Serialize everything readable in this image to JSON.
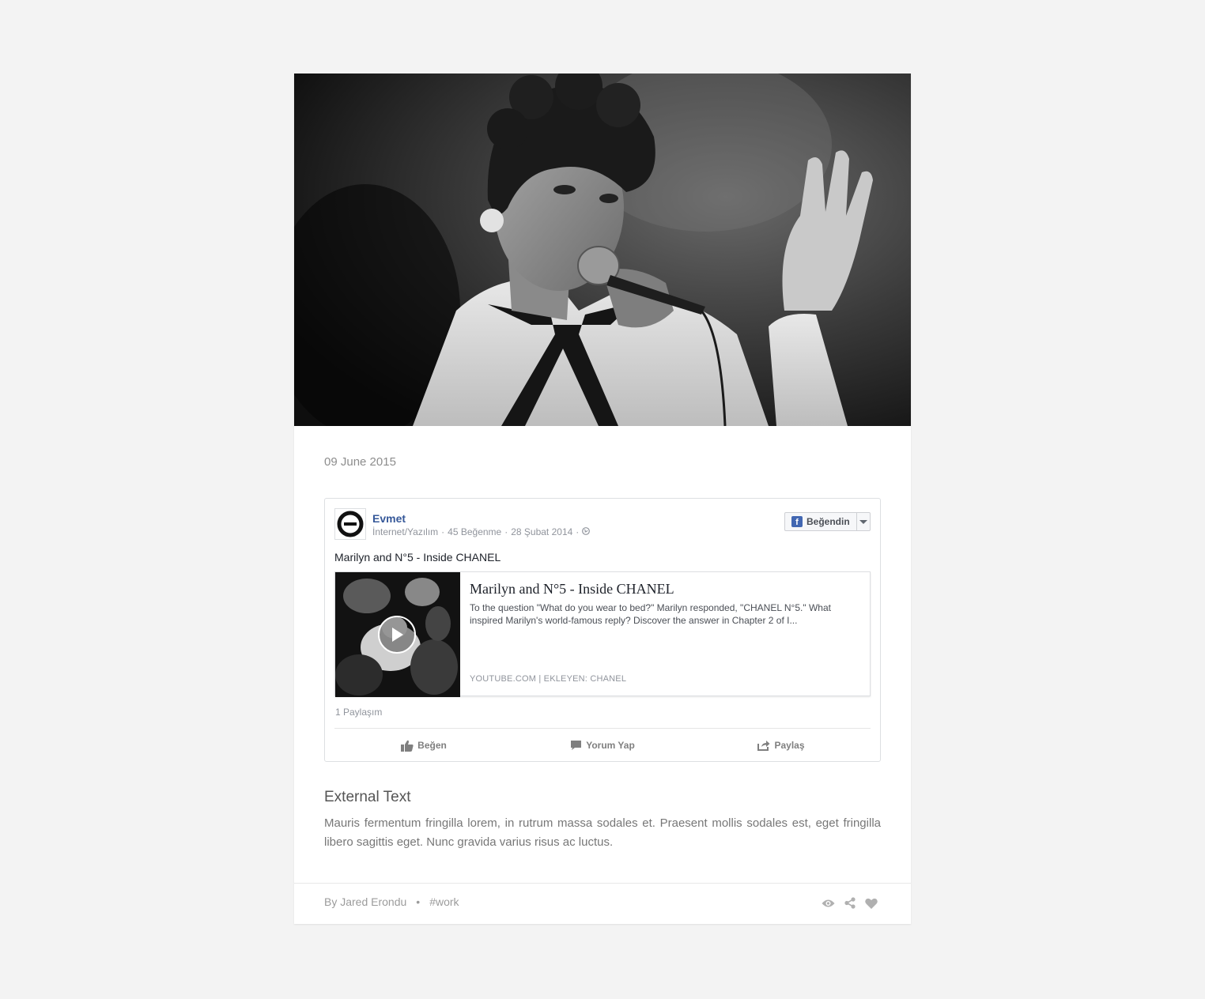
{
  "post": {
    "date": "09 June 2015",
    "external_title": "External Text",
    "external_body": "Mauris fermentum fringilla lorem, in rutrum massa sodales et. Praesent mollis sodales est, eget fringilla libero sagittis eget. Nunc gravida varius risus ac luctus.",
    "author": "By Jared Erondu",
    "separator": "•",
    "tag": "#work"
  },
  "fb_embed": {
    "page_name": "Evmet",
    "category": "İnternet/Yazılım",
    "likes": "45 Beğenme",
    "post_date": "28 Şubat 2014",
    "meta_sep": "·",
    "like_button": "Beğendin",
    "post_text": "Marilyn and N°5 - Inside CHANEL",
    "link_title": "Marilyn and N°5 - Inside CHANEL",
    "link_desc": "To the question \"What do you wear to bed?\" Marilyn responded, \"CHANEL N°5.\" What inspired Marilyn's world-famous reply? Discover the answer in Chapter 2 of I...",
    "link_source": "YOUTUBE.COM | EKLEYEN: CHANEL",
    "shares": "1 Paylaşım",
    "actions": {
      "like": "Beğen",
      "comment": "Yorum Yap",
      "share": "Paylaş"
    }
  },
  "icons": {
    "globe": "globe-icon",
    "play": "play-icon",
    "thumbs_up": "thumbs-up-icon",
    "comment": "comment-icon",
    "share": "share-icon",
    "views": "eye-icon",
    "footer_share": "share-nodes-icon",
    "heart": "heart-icon"
  },
  "colors": {
    "background": "#f3f3f3",
    "card": "#ffffff",
    "fb_link": "#365899",
    "fb_blue": "#4267b2"
  }
}
